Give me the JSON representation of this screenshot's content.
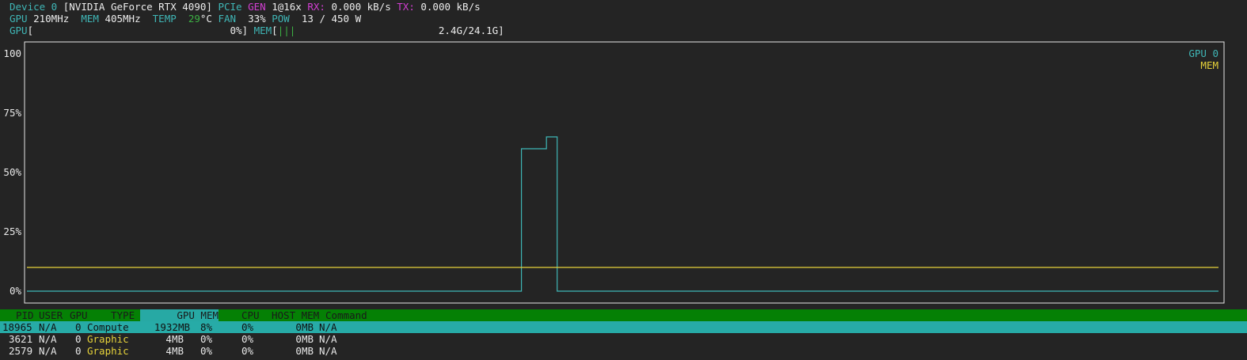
{
  "device": {
    "device_label": "Device 0",
    "name": "[NVIDIA GeForce RTX 4090]",
    "pcie_label": "PCIe",
    "gen_label": "GEN",
    "gen_value": "1@16x",
    "rx_label": "RX:",
    "rx_value": "0.000 kB/s",
    "tx_label": "TX:",
    "tx_value": "0.000 kB/s"
  },
  "stats": {
    "gpu_label": "GPU",
    "gpu_clock": "210MHz",
    "mem_label": "MEM",
    "mem_clock": "405MHz",
    "temp_label": "TEMP",
    "temp_value": "29",
    "temp_unit": "°C",
    "fan_label": "FAN",
    "fan_value": "33%",
    "pow_label": "POW",
    "pow_value": "13 / 450 W"
  },
  "bars": {
    "gpu_label": "GPU",
    "gpu_open": "[",
    "gpu_value": "0%]",
    "mem_label": "MEM",
    "mem_open": "[",
    "mem_fill": "|||",
    "mem_value": "2.4G/24.1G]"
  },
  "colors": {
    "cyan": "#3fb6b6",
    "magenta": "#d23fd2",
    "green": "#3cb043",
    "yellow": "#e6d23a",
    "header_green": "#058005",
    "selection_teal": "#27aba7"
  },
  "chart_data": {
    "type": "line",
    "y_ticks": [
      "100",
      "75%",
      "50%",
      "25%",
      "0%"
    ],
    "ylim": [
      0,
      100
    ],
    "legend": [
      "GPU 0",
      "MEM"
    ],
    "legend_position": "top-right",
    "series": [
      {
        "name": "GPU 0",
        "color": "#3fb6b6",
        "points": [
          [
            0,
            0
          ],
          [
            0.415,
            0
          ],
          [
            0.415,
            60
          ],
          [
            0.436,
            60
          ],
          [
            0.436,
            65
          ],
          [
            0.445,
            65
          ],
          [
            0.445,
            0
          ],
          [
            1,
            0
          ]
        ]
      },
      {
        "name": "MEM",
        "color": "#e6d23a",
        "points": [
          [
            0,
            10
          ],
          [
            1,
            10
          ]
        ]
      }
    ]
  },
  "processes": {
    "headers": [
      "PID",
      "USER",
      "GPU",
      "TYPE",
      "GPU MEM",
      "CPU",
      "HOST MEM",
      "Command"
    ],
    "rows": [
      {
        "pid": "18965",
        "user": "N/A",
        "gpu": "0",
        "type": "Compute",
        "gpu_mem": "1932MB",
        "gpu_mem_pct": "8%",
        "cpu": "0%",
        "host_mem": "0MB",
        "command": "N/A"
      },
      {
        "pid": "3621",
        "user": "N/A",
        "gpu": "0",
        "type": "Graphic",
        "gpu_mem": "4MB",
        "gpu_mem_pct": "0%",
        "cpu": "0%",
        "host_mem": "0MB",
        "command": "N/A"
      },
      {
        "pid": "2579",
        "user": "N/A",
        "gpu": "0",
        "type": "Graphic",
        "gpu_mem": "4MB",
        "gpu_mem_pct": "0%",
        "cpu": "0%",
        "host_mem": "0MB",
        "command": "N/A"
      }
    ]
  }
}
